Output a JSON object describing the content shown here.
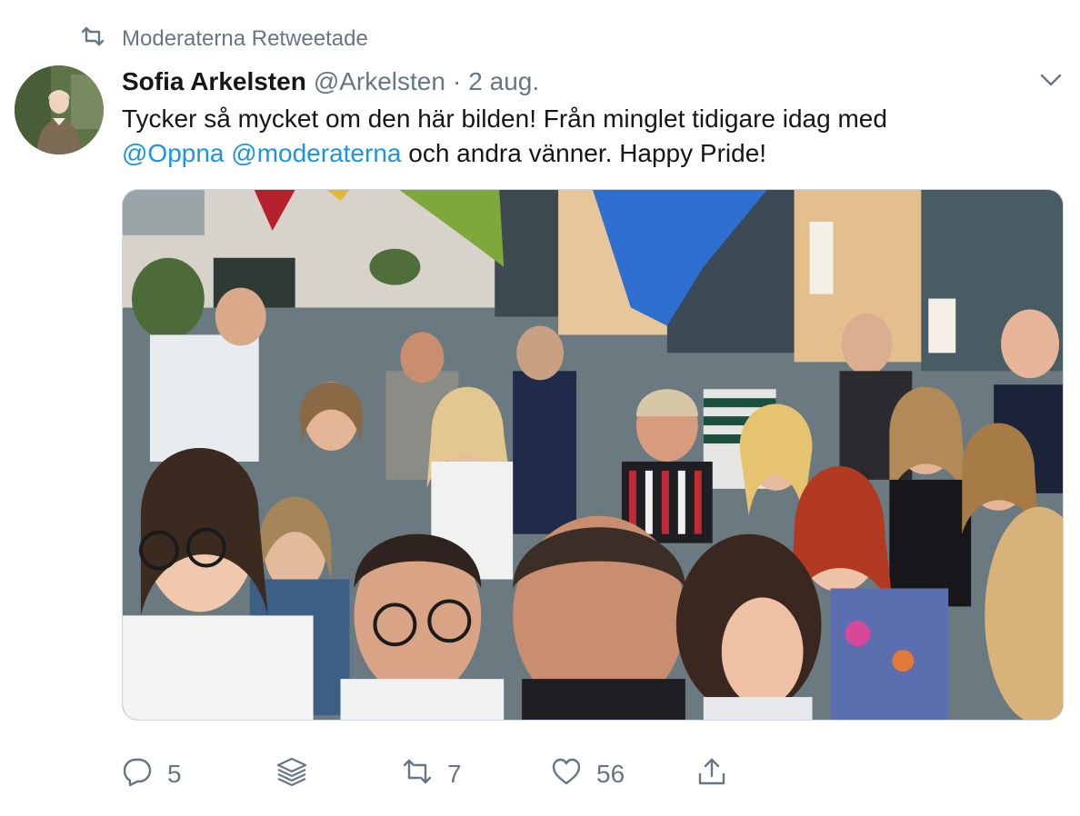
{
  "social_context": {
    "icon": "retweet-icon",
    "text": "Moderaterna Retweetade"
  },
  "tweet": {
    "author_name": "Sofia Arkelsten",
    "handle": "@Arkelsten",
    "separator": "·",
    "date": "2 aug.",
    "text_part1": "Tycker så mycket om den här bilden! Från minglet tidigare idag med",
    "mention1": "@Oppna",
    "mention2": "@moderaterna",
    "text_part2": "och andra vänner. Happy Pride!"
  },
  "actions": {
    "reply_count": "5",
    "retweet_count": "7",
    "like_count": "56"
  },
  "colors": {
    "text": "#14171a",
    "secondary": "#657786",
    "link": "#1b95e0",
    "border": "#ccd6dd"
  }
}
